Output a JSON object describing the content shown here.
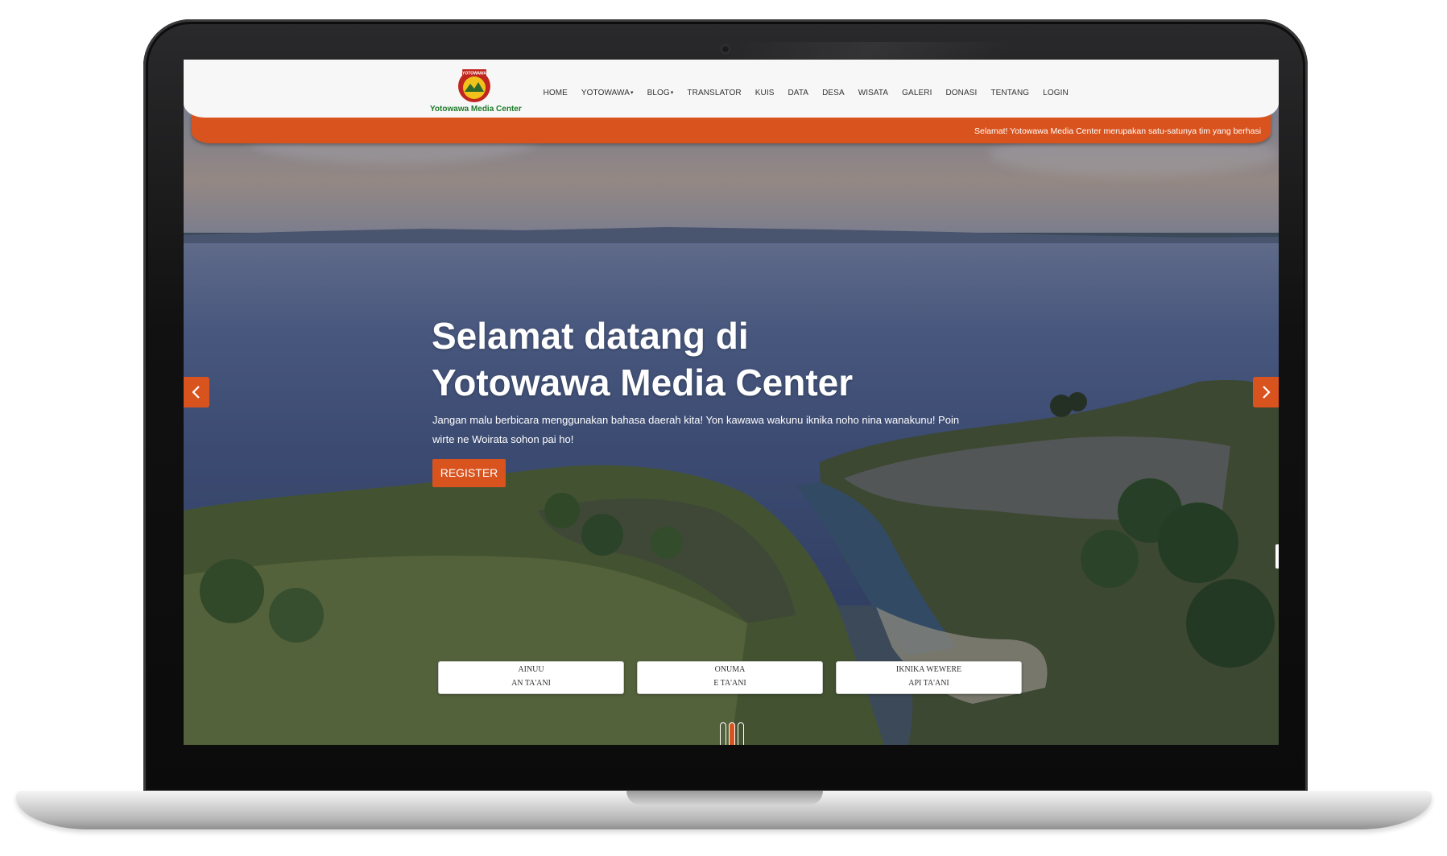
{
  "site": {
    "logo_name": "Yotowawa Media Center",
    "logo_badge": "YOTOWAWA"
  },
  "nav": {
    "items": [
      {
        "label": "HOME",
        "dropdown": false
      },
      {
        "label": "YOTOWAWA",
        "dropdown": true
      },
      {
        "label": "BLOG",
        "dropdown": true
      },
      {
        "label": "TRANSLATOR",
        "dropdown": false
      },
      {
        "label": "KUIS",
        "dropdown": false
      },
      {
        "label": "DATA",
        "dropdown": false
      },
      {
        "label": "DESA",
        "dropdown": false
      },
      {
        "label": "WISATA",
        "dropdown": false
      },
      {
        "label": "GALERI",
        "dropdown": false
      },
      {
        "label": "DONASI",
        "dropdown": false
      },
      {
        "label": "TENTANG",
        "dropdown": false
      },
      {
        "label": "LOGIN",
        "dropdown": false
      }
    ]
  },
  "ticker": {
    "text": "Selamat! Yotowawa Media Center merupakan satu-satunya tim yang berhasil m"
  },
  "hero": {
    "title_line1": "Selamat datang di",
    "title_line2": "Yotowawa Media Center",
    "subtitle": "Jangan malu berbicara menggunakan bahasa daerah kita! Yon kawawa wakunu iknika noho nina wanakunu! Poin wirte ne Woirata sohon pai ho!",
    "register_label": "REGISTER",
    "prev_icon": "chevron-left-icon",
    "next_icon": "chevron-right-icon"
  },
  "features": [
    {
      "line1": "AINUU",
      "line2": "AN TA'ANI"
    },
    {
      "line1": "ONUMA",
      "line2": "E TA'ANI"
    },
    {
      "line1": "IKNIKA WEWERE",
      "line2": "API TA'ANI"
    }
  ],
  "carousel": {
    "slides": 3,
    "active_index": 1
  },
  "colors": {
    "accent": "#d9531e",
    "navbar_bg": "#f7f7f7",
    "logo_green": "#1f7a2b"
  }
}
